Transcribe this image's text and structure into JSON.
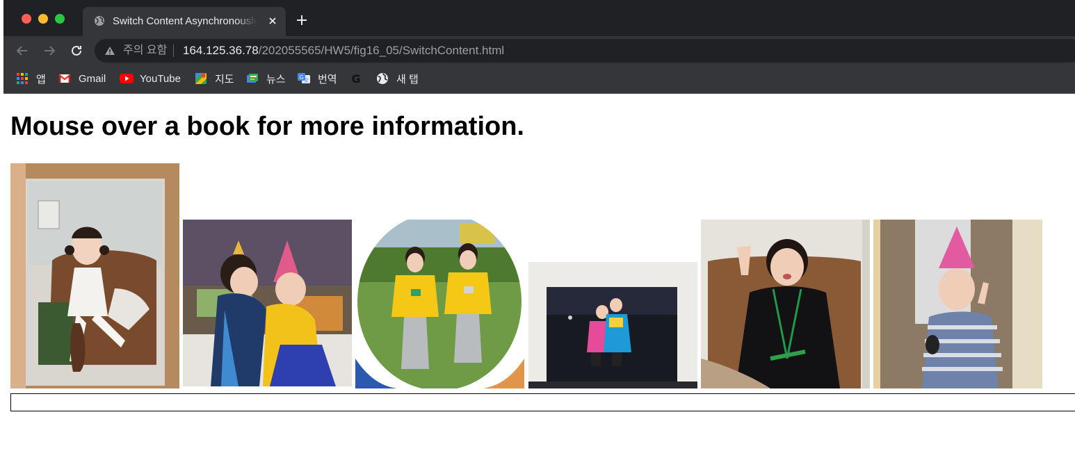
{
  "browser": {
    "tab_title": "Switch Content Asynchronously",
    "address": {
      "security_label": "주의 요함",
      "url_host": "164.125.36.78",
      "url_path": "/202055565/HW5/fig16_05/SwitchContent.html"
    },
    "bookmarks": [
      {
        "label": "앱",
        "icon": "apps-grid-icon"
      },
      {
        "label": "Gmail",
        "icon": "gmail-icon"
      },
      {
        "label": "YouTube",
        "icon": "youtube-icon"
      },
      {
        "label": "지도",
        "icon": "maps-icon"
      },
      {
        "label": "뉴스",
        "icon": "news-icon"
      },
      {
        "label": "번역",
        "icon": "translate-icon"
      },
      {
        "label": "",
        "icon": "g-letter-icon"
      },
      {
        "label": "새 탭",
        "icon": "globe-icon"
      }
    ]
  },
  "page": {
    "heading": "Mouse over a book for more information.",
    "info_text": "",
    "photos": [
      {
        "name": "photo-1",
        "subject": "child-in-white-dress-on-sofa"
      },
      {
        "name": "photo-2",
        "subject": "two-children-party-hats"
      },
      {
        "name": "photo-3",
        "subject": "two-children-yellow-jackets-outdoors"
      },
      {
        "name": "photo-4",
        "subject": "two-children-pink-blue-snapshot"
      },
      {
        "name": "photo-5",
        "subject": "child-black-outfit-on-sofa"
      },
      {
        "name": "photo-6",
        "subject": "toddler-with-party-hat"
      }
    ]
  }
}
